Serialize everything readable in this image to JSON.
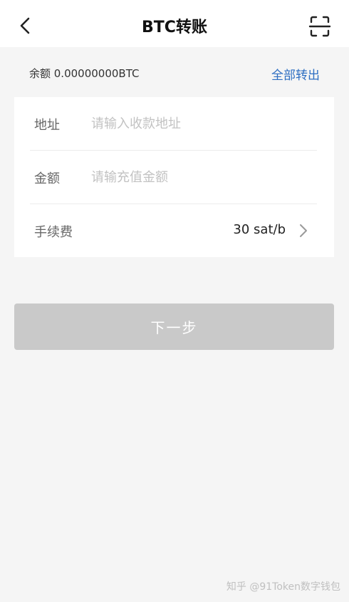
{
  "header": {
    "back_icon": "chevron-left-icon",
    "title": "BTC转账",
    "scan_icon": "scan-icon"
  },
  "balance": {
    "text": "余额 0.00000000BTC",
    "transfer_all": "全部转出"
  },
  "form": {
    "address": {
      "label": "地址",
      "placeholder": "请输入收款地址",
      "value": ""
    },
    "amount": {
      "label": "金额",
      "placeholder": "请输充值金额",
      "value": ""
    },
    "fee": {
      "label": "手续费",
      "value": "30 sat/b",
      "icon": "chevron-right-icon"
    }
  },
  "next_button": {
    "label": "下一步",
    "disabled": true
  },
  "watermark": "知乎 @91Token数字钱包",
  "colors": {
    "background": "#f5f5f5",
    "card": "#ffffff",
    "link": "#2f6fc2",
    "button_disabled": "#c9c9c9",
    "placeholder": "#c2c2c2"
  }
}
